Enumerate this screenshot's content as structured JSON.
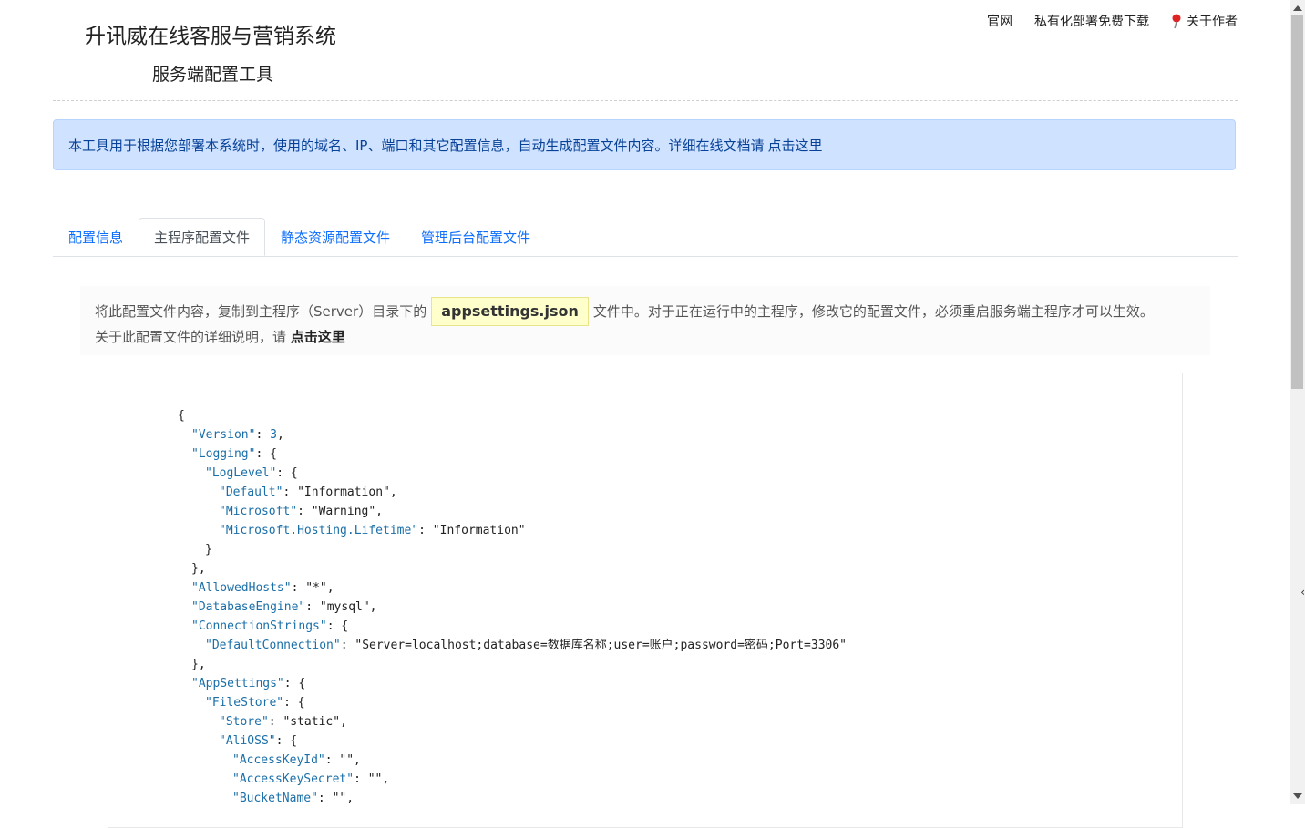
{
  "header": {
    "title": "升讯威在线客服与营销系统",
    "subtitle": "服务端配置工具",
    "nav": [
      {
        "label": "官网"
      },
      {
        "label": "私有化部署免费下载"
      },
      {
        "label": "关于作者",
        "icon": "pin-icon"
      }
    ]
  },
  "alert": {
    "text": "本工具用于根据您部署本系统时，使用的域名、IP、端口和其它配置信息，自动生成配置文件内容。详细在线文档请",
    "link": "点击这里"
  },
  "tabs": [
    {
      "label": "配置信息",
      "active": false
    },
    {
      "label": "主程序配置文件",
      "active": true
    },
    {
      "label": "静态资源配置文件",
      "active": false
    },
    {
      "label": "管理后台配置文件",
      "active": false
    }
  ],
  "note": {
    "before": "将此配置文件内容，复制到主程序（Server）目录下的",
    "filename": "appsettings.json",
    "after": "文件中。对于正在运行中的主程序，修改它的配置文件，必须重启服务端主程序才可以生效。",
    "line2_text": "关于此配置文件的详细说明，请",
    "line2_link": "点击这里"
  },
  "code": {
    "lines": [
      {
        "indent": 0,
        "parts": [
          [
            "p",
            "{"
          ]
        ]
      },
      {
        "indent": 1,
        "parts": [
          [
            "k",
            "\"Version\""
          ],
          [
            "p",
            ": "
          ],
          [
            "n",
            "3"
          ],
          [
            "p",
            ","
          ]
        ]
      },
      {
        "indent": 1,
        "parts": [
          [
            "k",
            "\"Logging\""
          ],
          [
            "p",
            ": {"
          ]
        ]
      },
      {
        "indent": 2,
        "parts": [
          [
            "k",
            "\"LogLevel\""
          ],
          [
            "p",
            ": {"
          ]
        ]
      },
      {
        "indent": 3,
        "parts": [
          [
            "k",
            "\"Default\""
          ],
          [
            "p",
            ": \"Information\","
          ]
        ]
      },
      {
        "indent": 3,
        "parts": [
          [
            "k",
            "\"Microsoft\""
          ],
          [
            "p",
            ": \"Warning\","
          ]
        ]
      },
      {
        "indent": 3,
        "parts": [
          [
            "k",
            "\"Microsoft.Hosting.Lifetime\""
          ],
          [
            "p",
            ": \"Information\""
          ]
        ]
      },
      {
        "indent": 2,
        "parts": [
          [
            "p",
            "}"
          ]
        ]
      },
      {
        "indent": 1,
        "parts": [
          [
            "p",
            "},"
          ]
        ]
      },
      {
        "indent": 1,
        "parts": [
          [
            "k",
            "\"AllowedHosts\""
          ],
          [
            "p",
            ": \"*\","
          ]
        ]
      },
      {
        "indent": 1,
        "parts": [
          [
            "k",
            "\"DatabaseEngine\""
          ],
          [
            "p",
            ": \"mysql\","
          ]
        ]
      },
      {
        "indent": 1,
        "parts": [
          [
            "k",
            "\"ConnectionStrings\""
          ],
          [
            "p",
            ": {"
          ]
        ]
      },
      {
        "indent": 2,
        "parts": [
          [
            "k",
            "\"DefaultConnection\""
          ],
          [
            "p",
            ": \"Server=localhost;database=数据库名称;user=账户;password=密码;Port=3306\""
          ]
        ]
      },
      {
        "indent": 1,
        "parts": [
          [
            "p",
            "},"
          ]
        ]
      },
      {
        "indent": 1,
        "parts": [
          [
            "k",
            "\"AppSettings\""
          ],
          [
            "p",
            ": {"
          ]
        ]
      },
      {
        "indent": 2,
        "parts": [
          [
            "k",
            "\"FileStore\""
          ],
          [
            "p",
            ": {"
          ]
        ]
      },
      {
        "indent": 3,
        "parts": [
          [
            "k",
            "\"Store\""
          ],
          [
            "p",
            ": \"static\","
          ]
        ]
      },
      {
        "indent": 3,
        "parts": [
          [
            "k",
            "\"AliOSS\""
          ],
          [
            "p",
            ": {"
          ]
        ]
      },
      {
        "indent": 4,
        "parts": [
          [
            "k",
            "\"AccessKeyId\""
          ],
          [
            "p",
            ": \"\","
          ]
        ]
      },
      {
        "indent": 4,
        "parts": [
          [
            "k",
            "\"AccessKeySecret\""
          ],
          [
            "p",
            ": \"\","
          ]
        ]
      },
      {
        "indent": 4,
        "parts": [
          [
            "k",
            "\"BucketName\""
          ],
          [
            "p",
            ": \"\","
          ]
        ]
      }
    ]
  },
  "colors": {
    "alert_bg": "#cfe2ff",
    "link": "#0d6efd",
    "json_key": "#1a6fa8",
    "filename_highlight": "#ffffcc"
  }
}
